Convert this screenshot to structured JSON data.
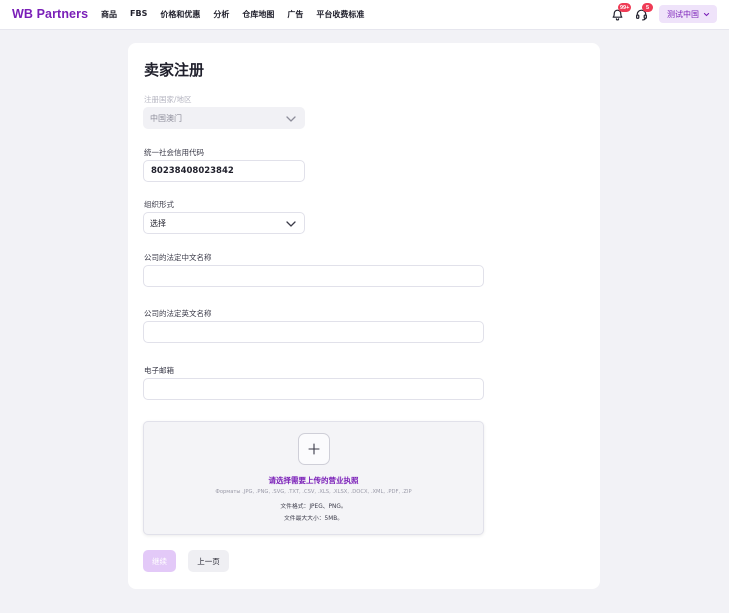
{
  "header": {
    "logo": "WB Partners",
    "nav": [
      "商品",
      "FBS",
      "价格和优惠",
      "分析",
      "仓库地图",
      "广告",
      "平台收费标准"
    ],
    "notifications_badge": "99+",
    "support_badge": "5",
    "region": "测试中国"
  },
  "form": {
    "title": "卖家注册",
    "country_label": "注册国家/地区",
    "country_value": "中国澳门",
    "credit_code_label": "统一社会信用代码",
    "credit_code_value": "80238408023842",
    "org_form_label": "组织形式",
    "org_form_value": "选择",
    "name_cn_label": "公司的法定中文名称",
    "name_en_label": "公司的法定英文名称",
    "email_label": "电子邮箱"
  },
  "upload": {
    "title": "请选择需要上传的营业执照",
    "formats": "Форматы .JPG, .PNG, .SVG, .TXT, .CSV, .XLS, .XLSX, .DOCX, .XML, .PDF, .ZIP",
    "file_format_note": "文件格式：JPEG、PNG。",
    "max_size_note": "文件最大大小：5MB。"
  },
  "buttons": {
    "next": "继续",
    "prev": "上一页"
  },
  "colors": {
    "brand": "#7a1fb8",
    "badge": "#ef3b55",
    "disabled_button": "#e3c9f8"
  }
}
